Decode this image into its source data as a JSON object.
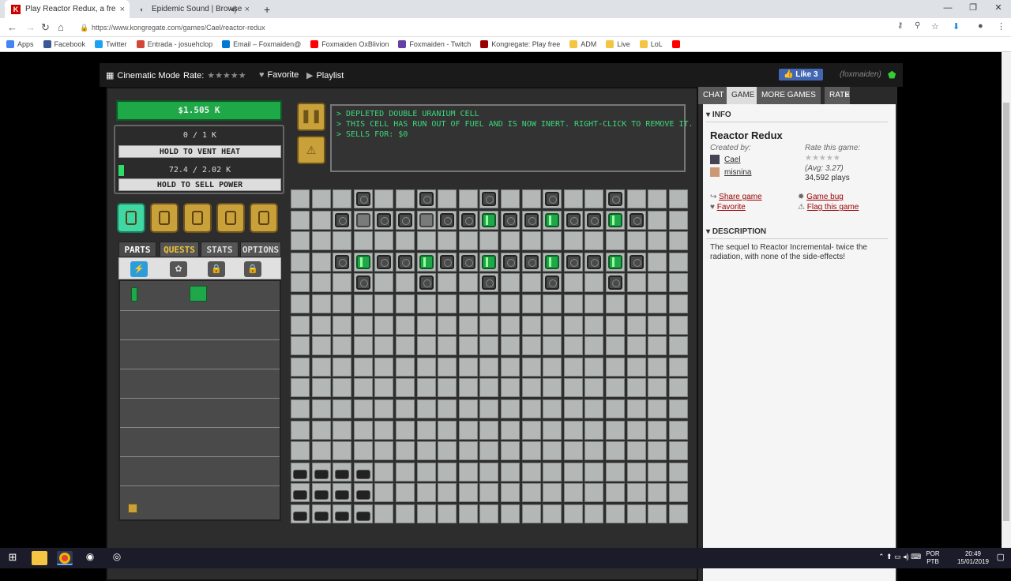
{
  "browser": {
    "tabs": [
      {
        "title": "Play Reactor Redux, a free online...",
        "favicon": "K"
      },
      {
        "title": "Epidemic Sound | Browse",
        "favicon": "epidemic-icon"
      }
    ],
    "new_tab": "+",
    "url": "https://www.kongregate.com/games/Cael/reactor-redux",
    "bookmarks": [
      {
        "label": "Apps",
        "color": "#4285f4"
      },
      {
        "label": "Facebook",
        "color": "#3b5998"
      },
      {
        "label": "Twitter",
        "color": "#1da1f2"
      },
      {
        "label": "Entrada - josuehclop",
        "color": "#d44638"
      },
      {
        "label": "Email – Foxmaiden@",
        "color": "#0078d4"
      },
      {
        "label": "Foxmaiden OxBlivion",
        "color": "#ff0000"
      },
      {
        "label": "Foxmaiden - Twitch",
        "color": "#6441a5"
      },
      {
        "label": "Kongregate: Play free",
        "color": "#990000"
      },
      {
        "label": "ADM",
        "color": "#f4c542"
      },
      {
        "label": "Live",
        "color": "#f4c542"
      },
      {
        "label": "LoL",
        "color": "#f4c542"
      },
      {
        "label": "",
        "color": "#ff0000"
      }
    ]
  },
  "topbar": {
    "cinematic": "Cinematic Mode",
    "rate": "Rate:",
    "favorite": "Favorite",
    "playlist": "Playlist",
    "like": "Like 3",
    "user": "(foxmaiden)"
  },
  "game": {
    "money": "$1.505 K",
    "heat": "0 / 1 K",
    "vent_btn": "HOLD TO VENT HEAT",
    "power": "72.4 / 2.02 K",
    "power_fraction": 0.036,
    "sell_btn": "HOLD TO SELL POWER",
    "tabs": [
      "PARTS",
      "QUESTS",
      "STATS",
      "OPTIONS"
    ],
    "messages": [
      "> DEPLETED DOUBLE URANIUM CELL",
      "> THIS CELL HAS RUN OUT OF FUEL AND IS NOW INERT. RIGHT-CLICK TO REMOVE IT.",
      "> SELLS FOR: $0"
    ]
  },
  "sidebar": {
    "tabs": [
      "CHAT",
      "GAME",
      "MORE GAMES",
      "RATE"
    ],
    "close": "×",
    "info_header": "INFO",
    "title": "Reactor Redux",
    "created_by": "Created by:",
    "creators": [
      "Cael",
      "misnina"
    ],
    "rate_label": "Rate this game:",
    "avg": "(Avg: 3.27)",
    "plays": "34,592 plays",
    "links": [
      "Share game",
      "Game bug",
      "Favorite",
      "Flag this game"
    ],
    "desc_header": "DESCRIPTION",
    "description": "The sequel to Reactor Incremental- twice the radiation, with none of the side-effects!"
  },
  "taskbar": {
    "lang": "POR",
    "lang2": "PTB",
    "time": "20:49",
    "date": "15/01/2019"
  }
}
